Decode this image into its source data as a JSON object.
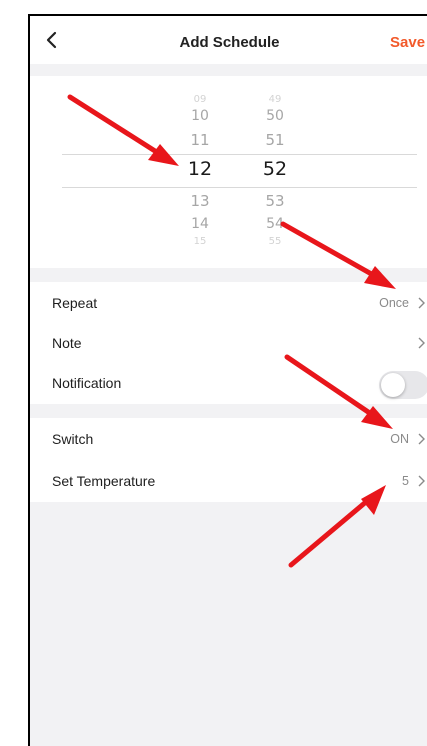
{
  "header": {
    "title": "Add Schedule",
    "save_label": "Save",
    "back_icon": "chevron-left-icon"
  },
  "time_picker": {
    "hours": [
      "09",
      "10",
      "11",
      "12",
      "13",
      "14",
      "15"
    ],
    "minutes": [
      "49",
      "50",
      "51",
      "52",
      "53",
      "54",
      "55"
    ],
    "selected_hour": "12",
    "selected_minute": "52"
  },
  "settings": {
    "repeat": {
      "label": "Repeat",
      "value": "Once"
    },
    "note": {
      "label": "Note"
    },
    "notification": {
      "label": "Notification",
      "enabled": false
    },
    "switch": {
      "label": "Switch",
      "value": "ON"
    },
    "set_temperature": {
      "label": "Set Temperature",
      "value": "5"
    }
  },
  "colors": {
    "accent": "#f25a2b",
    "annotation_arrow": "#e8161b",
    "section_bg": "#f2f2f4"
  }
}
